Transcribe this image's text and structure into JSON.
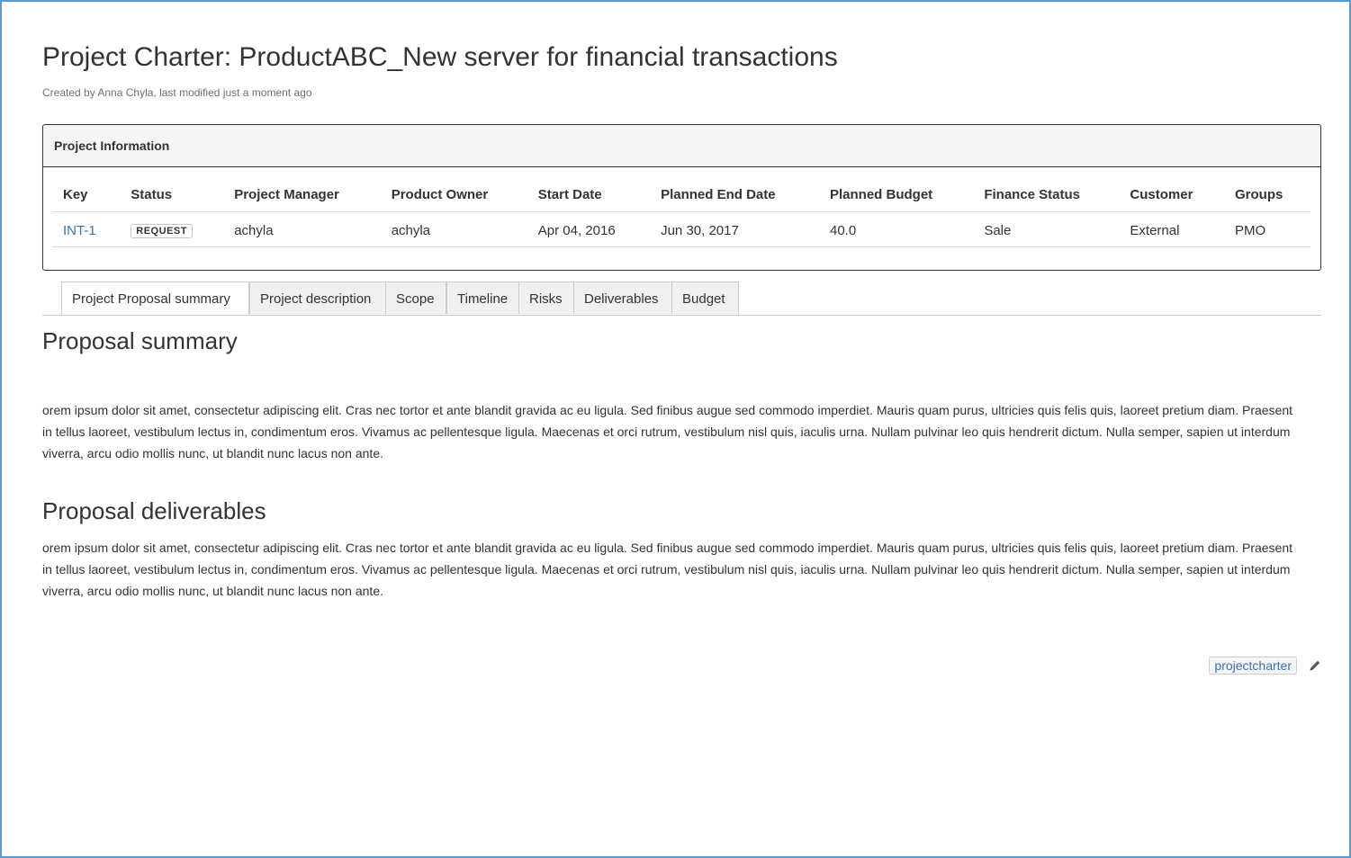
{
  "page": {
    "title": "Project Charter: ProductABC_New server for financial transactions",
    "byline": "Created by Anna Chyla, last modified just a moment ago"
  },
  "project_info": {
    "heading": "Project Information",
    "columns": [
      "Key",
      "Status",
      "Project Manager",
      "Product Owner",
      "Start Date",
      "Planned End Date",
      "Planned Budget",
      "Finance Status",
      "Customer",
      "Groups"
    ],
    "row": {
      "key": "INT-1",
      "status": "REQUEST",
      "project_manager": "achyla",
      "product_owner": "achyla",
      "start_date": "Apr 04, 2016",
      "planned_end_date": "Jun 30, 2017",
      "planned_budget": "40.0",
      "finance_status": "Sale",
      "customer": "External",
      "groups": "PMO"
    }
  },
  "tabs": [
    {
      "label": "Project Proposal summary",
      "active": true
    },
    {
      "label": "Project description",
      "active": false
    },
    {
      "label": "Scope",
      "active": false
    },
    {
      "label": "Timeline",
      "active": false
    },
    {
      "label": "Risks",
      "active": false
    },
    {
      "label": "Deliverables",
      "active": false
    },
    {
      "label": "Budget",
      "active": false
    }
  ],
  "sections": {
    "summary": {
      "heading": "Proposal summary",
      "text": "orem ipsum dolor sit amet, consectetur adipiscing elit. Cras nec tortor et ante blandit gravida ac eu ligula. Sed finibus augue sed commodo imperdiet. Mauris quam purus, ultricies quis felis quis, laoreet pretium diam. Praesent in tellus laoreet, vestibulum lectus in, condimentum eros. Vivamus ac pellentesque ligula. Maecenas et orci rutrum, vestibulum nisl quis, iaculis urna. Nullam pulvinar leo quis hendrerit dictum. Nulla semper, sapien ut interdum viverra, arcu odio mollis nunc, ut blandit nunc lacus non ante."
    },
    "deliverables": {
      "heading": "Proposal deliverables",
      "text": "orem ipsum dolor sit amet, consectetur adipiscing elit. Cras nec tortor et ante blandit gravida ac eu ligula. Sed finibus augue sed commodo imperdiet. Mauris quam purus, ultricies quis felis quis, laoreet pretium diam. Praesent in tellus laoreet, vestibulum lectus in, condimentum eros. Vivamus ac pellentesque ligula. Maecenas et orci rutrum, vestibulum nisl quis, iaculis urna. Nullam pulvinar leo quis hendrerit dictum. Nulla semper, sapien ut interdum viverra, arcu odio mollis nunc, ut blandit nunc lacus non ante."
    }
  },
  "labels": {
    "items": [
      "projectcharter"
    ],
    "edit_icon": "pencil-icon"
  },
  "colors": {
    "frame_border": "#5b9bd5",
    "link": "#3572b0",
    "text": "#333333"
  }
}
